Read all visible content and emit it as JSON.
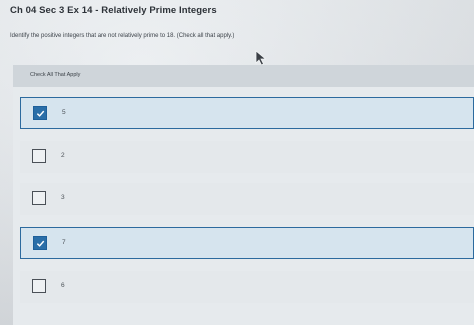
{
  "header": {
    "title": "Ch 04 Sec 3 Ex 14 - Relatively Prime Integers",
    "question": "Identify the positive integers that are not relatively prime to 18. (Check all that apply.)"
  },
  "panel": {
    "header_label": "Check All That Apply"
  },
  "options": [
    {
      "label": "5",
      "checked": true
    },
    {
      "label": "2",
      "checked": false
    },
    {
      "label": "3",
      "checked": false
    },
    {
      "label": "7",
      "checked": true
    },
    {
      "label": "6",
      "checked": false
    }
  ],
  "colors": {
    "accent": "#2a6ea8",
    "selected_border": "#2c6a9e",
    "selected_background": "#d6e4ee"
  },
  "icons": {
    "checkmark": "check-icon",
    "pointer": "mouse-cursor-icon"
  }
}
